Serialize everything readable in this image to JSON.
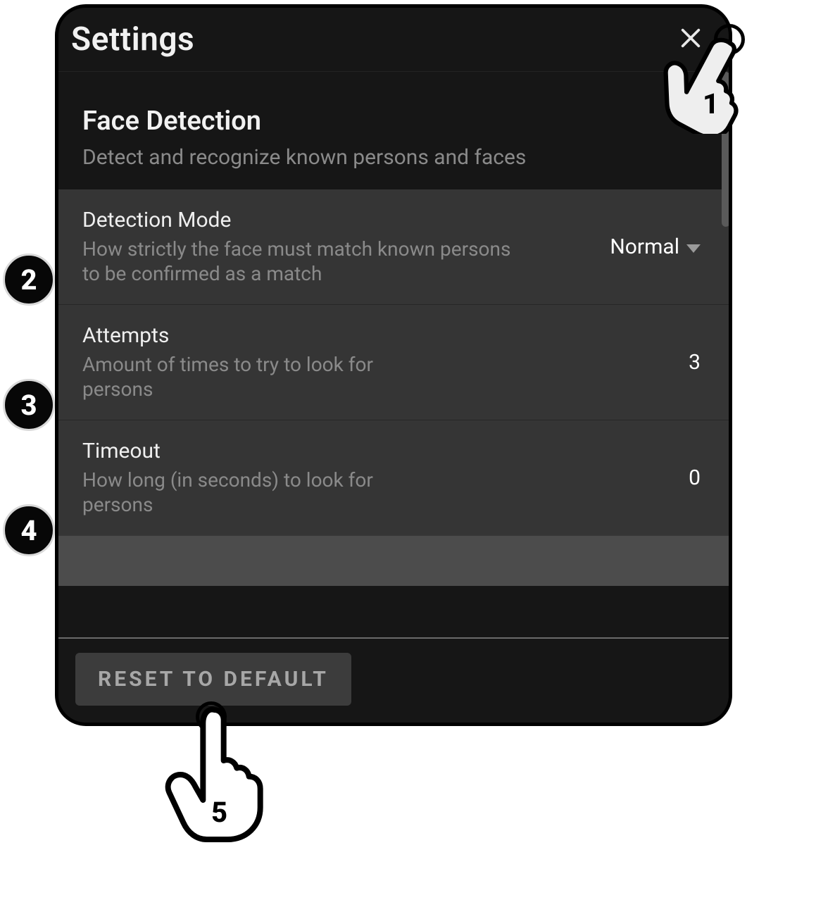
{
  "dialog": {
    "title": "Settings",
    "close_label": "Close"
  },
  "section": {
    "title": "Face Detection",
    "subtitle": "Detect and recognize known persons and faces"
  },
  "rows": {
    "detection_mode": {
      "label": "Detection Mode",
      "desc": "How strictly the face must match known persons to be confirmed as a match",
      "value": "Normal"
    },
    "attempts": {
      "label": "Attempts",
      "desc": "Amount of times to try to look for persons",
      "value": "3"
    },
    "timeout": {
      "label": "Timeout",
      "desc": "How long (in seconds) to look for persons",
      "value": "0"
    }
  },
  "footer": {
    "reset_label": "RESET TO DEFAULT"
  },
  "callouts": {
    "c1": "1",
    "c2": "2",
    "c3": "3",
    "c4": "4",
    "c5": "5"
  }
}
